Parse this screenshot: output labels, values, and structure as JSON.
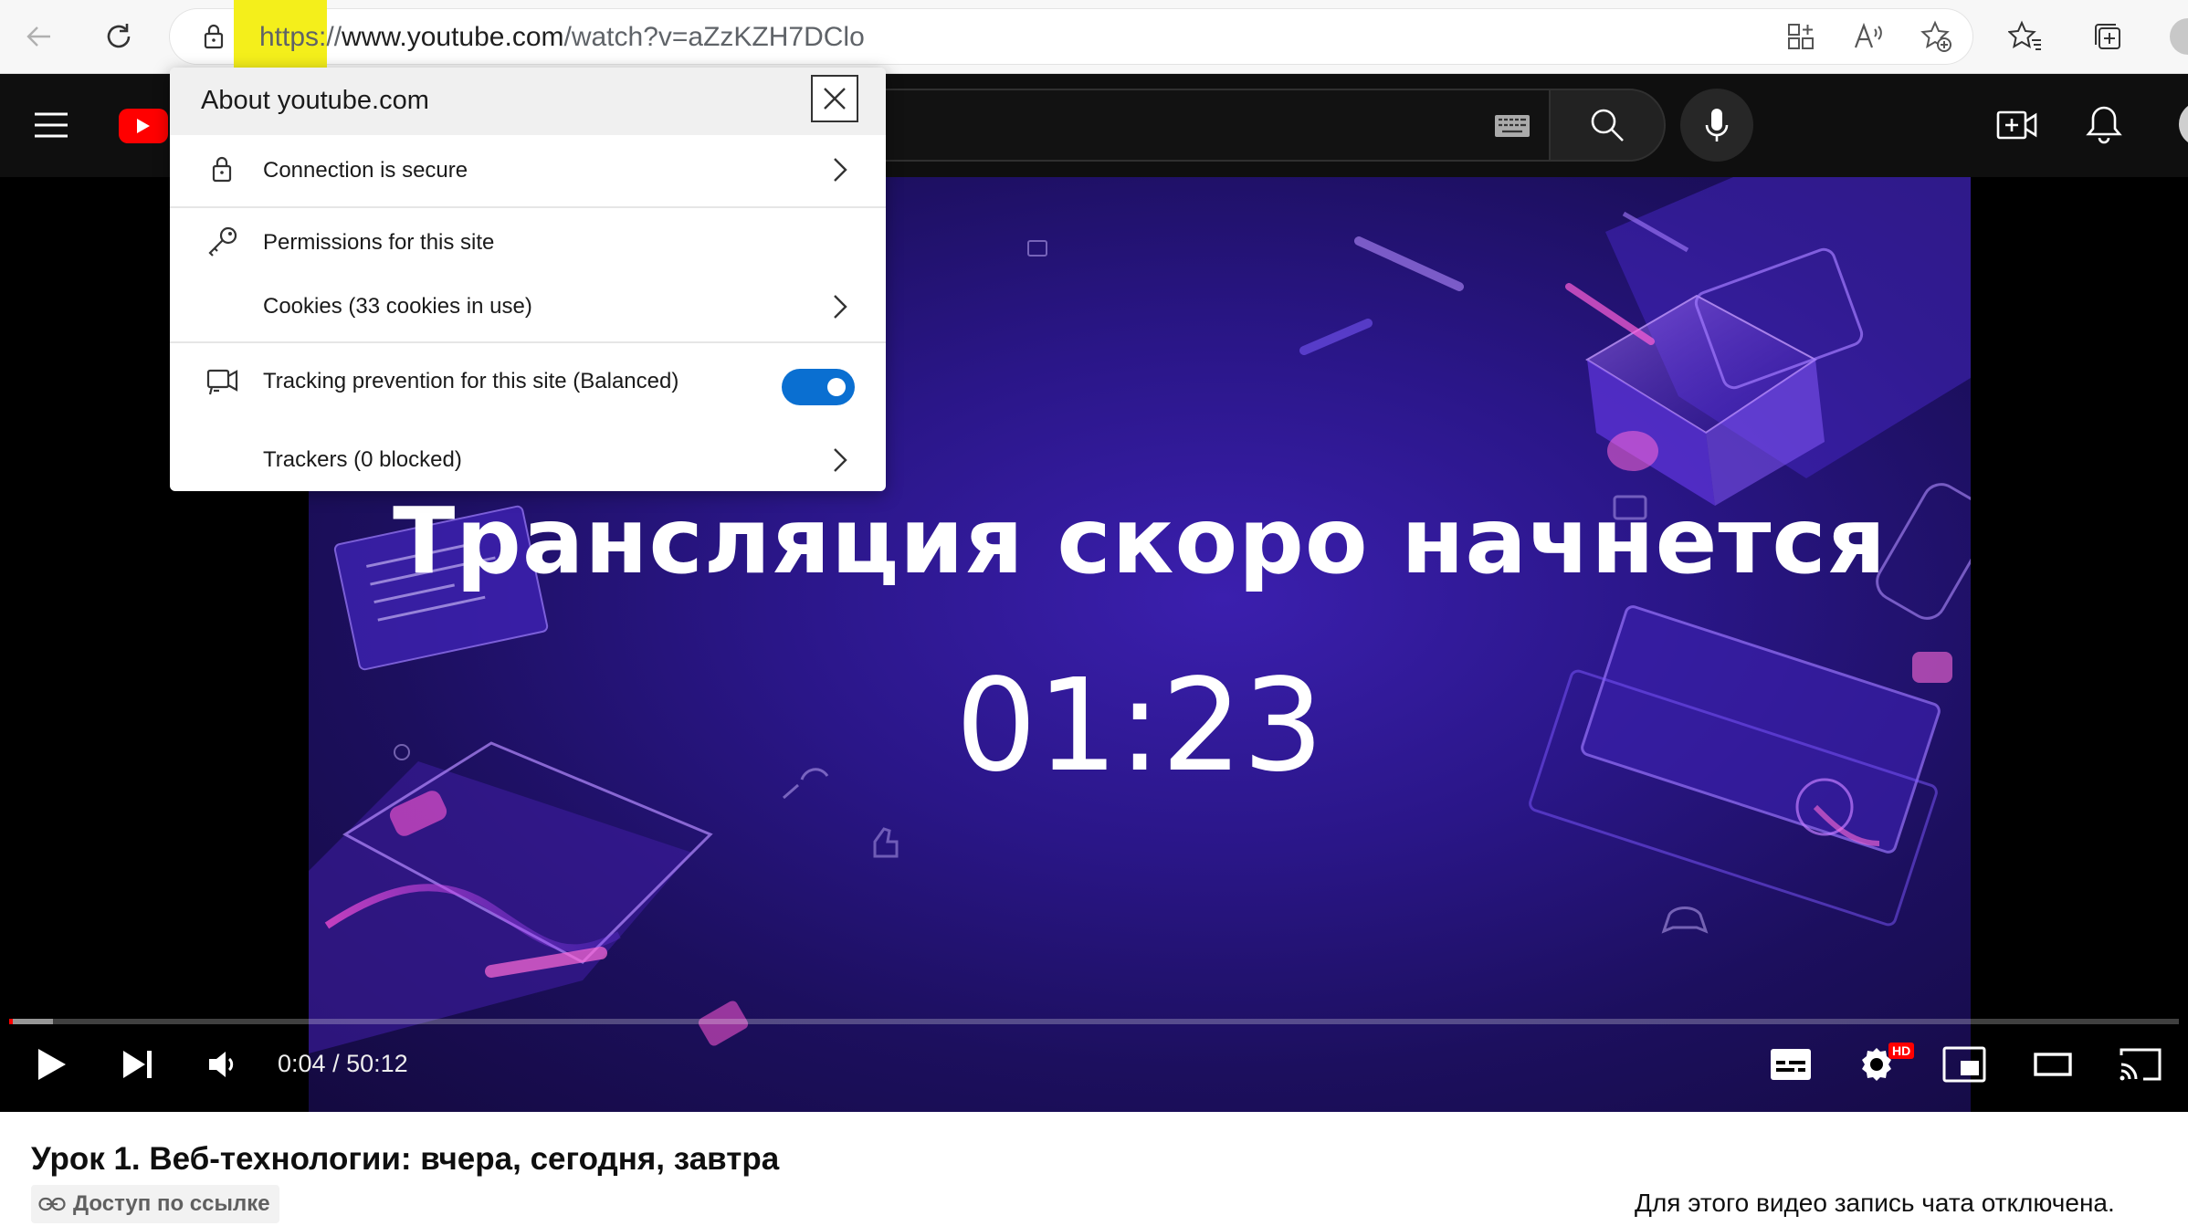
{
  "browser": {
    "url_protocol": "https://",
    "url_host": "www.youtube.com",
    "url_path": "/watch?v=aZzKZH7DClo"
  },
  "site_info": {
    "title": "About youtube.com",
    "connection_label": "Connection is secure",
    "permissions_label": "Permissions for this site",
    "cookies_label": "Cookies (33 cookies in use)",
    "tracking_label": "Tracking prevention for this site (Balanced)",
    "tracking_enabled": true,
    "trackers_label": "Trackers (0 blocked)"
  },
  "video": {
    "overlay_title": "Трансляция скоро начнется",
    "overlay_countdown": "01:23",
    "current_time": "0:04",
    "separator": " / ",
    "duration": "50:12",
    "progress_fraction": 0.0013,
    "hd_badge": "HD"
  },
  "page": {
    "title": "Урок 1. Веб-технологии: вчера, сегодня, завтра",
    "visibility_label": "Доступ по ссылке",
    "chat_disabled_text": "Для этого видео запись чата отключена."
  },
  "colors": {
    "youtube_red": "#ff0000",
    "toggle_blue": "#0a6fd1",
    "url_highlight": "#f4ef1b",
    "video_bg": "#2a1688"
  }
}
